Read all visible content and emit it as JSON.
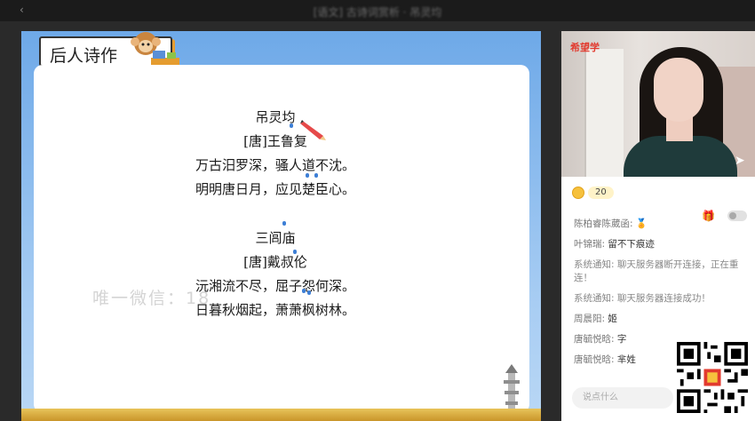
{
  "topbar": {
    "title": "[语文] 古诗词赏析 · 吊灵均",
    "back": "‹"
  },
  "slide": {
    "section_title": "后人诗作",
    "poem1": {
      "title": "吊灵均",
      "author": "[唐]王鲁复",
      "lines": [
        "万古汨罗深，骚人道不沈。",
        "明明唐日月，应见楚臣心。"
      ]
    },
    "poem2": {
      "title": "三闾庙",
      "author": "[唐]戴叔伦",
      "lines": [
        "沅湘流不尽，屈子怨何深。",
        "日暮秋烟起，萧萧枫树林。"
      ]
    },
    "watermark": "唯一微信：18"
  },
  "video": {
    "logo": "希望学"
  },
  "coins": {
    "count": "20"
  },
  "chat": [
    {
      "name": "陈柏睿陈葳函:",
      "text": "",
      "badge": "🏅"
    },
    {
      "name": "叶锦瑞:",
      "text": "留不下痕迹"
    },
    {
      "name": "系统通知:",
      "text": "聊天服务器断开连接，正在重连！",
      "system": true
    },
    {
      "name": "系统通知:",
      "text": "聊天服务器连接成功！",
      "system": true
    },
    {
      "name": "周晨阳:",
      "text": "姬"
    },
    {
      "name": "唐毓悦晗:",
      "text": "字"
    },
    {
      "name": "唐毓悦晗:",
      "text": "芈姓"
    }
  ],
  "input": {
    "placeholder": "说点什么"
  },
  "colors": {
    "accent": "#e59c2f",
    "brand": "#e23a2e",
    "slide_bg": "#6ea9e8"
  }
}
